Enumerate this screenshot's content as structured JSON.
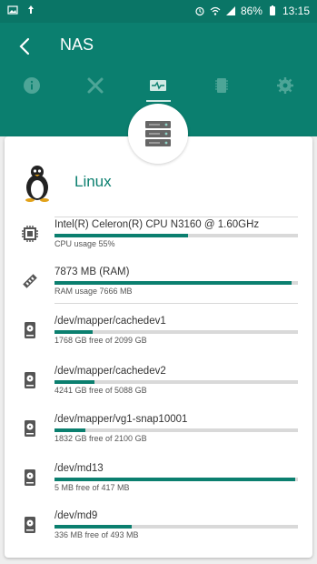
{
  "status_bar": {
    "battery": "86%",
    "time": "13:15"
  },
  "app_bar": {
    "title": "NAS"
  },
  "tabs": [
    {
      "icon": "info-icon"
    },
    {
      "icon": "tools-icon"
    },
    {
      "icon": "monitor-icon",
      "active": true
    },
    {
      "icon": "storage-icon"
    },
    {
      "icon": "settings-icon"
    }
  ],
  "system": {
    "os": "Linux",
    "cpu": {
      "name": "Intel(R) Celeron(R) CPU  N3160  @ 1.60GHz",
      "usage_text": "CPU usage 55%",
      "usage": 0.55
    },
    "ram": {
      "total_text": "7873 MB (RAM)",
      "usage_text": "RAM usage 7666 MB",
      "usage": 0.974
    },
    "disks": [
      {
        "path": "/dev/mapper/cachedev1",
        "free_text": "1768 GB free of 2099 GB",
        "used": 0.158
      },
      {
        "path": "/dev/mapper/cachedev2",
        "free_text": "4241 GB free of 5088 GB",
        "used": 0.166
      },
      {
        "path": "/dev/mapper/vg1-snap10001",
        "free_text": "1832 GB free of 2100 GB",
        "used": 0.128
      },
      {
        "path": "/dev/md13",
        "free_text": "5 MB free of 417 MB",
        "used": 0.988
      },
      {
        "path": "/dev/md9",
        "free_text": "336 MB free of 493 MB",
        "used": 0.318
      }
    ]
  },
  "colors": {
    "primary": "#0b7f6f",
    "status_bar": "#0a7566",
    "bar_track": "#d9d9d9"
  }
}
